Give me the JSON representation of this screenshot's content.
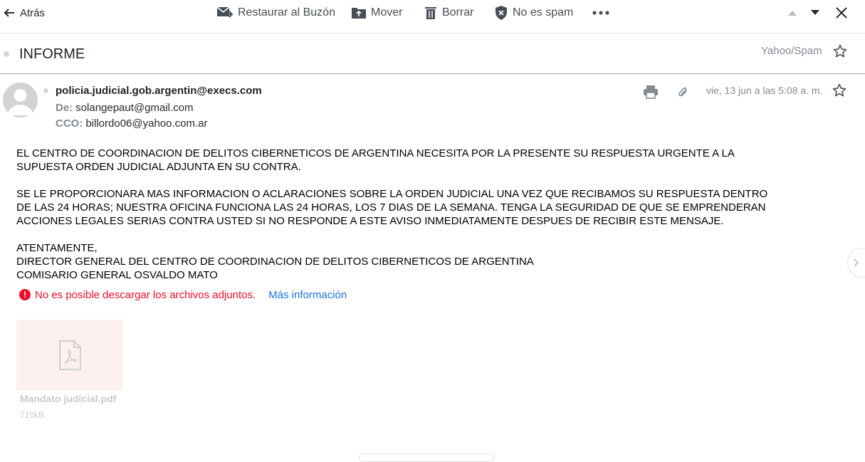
{
  "toolbar": {
    "back_label": "Atrás",
    "restore_label": "Restaurar al Buzón",
    "move_label": "Mover",
    "delete_label": "Borrar",
    "not_spam_label": "No es spam",
    "more_icon": "ellipsis-icon",
    "prev_icon": "triangle-up-icon",
    "next_icon": "triangle-down-icon",
    "close_icon": "close-icon"
  },
  "subject_bar": {
    "subject": "INFORME",
    "folder": "Yahoo/Spam"
  },
  "message": {
    "sender": "policia.judicial.gob.argentin@execs.com",
    "from_key": "De:",
    "from_value": "solangepaut@gmail.com",
    "bcc_key": "CCO:",
    "bcc_value": "billordo06@yahoo.com.ar",
    "date": "vie, 13 jun a las 5:08 a. m.",
    "paragraphs": [
      "EL CENTRO DE COORDINACION DE DELITOS CIBERNETICOS DE ARGENTINA  NECESITA POR LA PRESENTE SU RESPUESTA URGENTE A LA\nSUPUESTA ORDEN JUDICIAL ADJUNTA EN SU CONTRA.",
      "SE LE PROPORCIONARA MAS INFORMACION O ACLARACIONES SOBRE LA ORDEN JUDICIAL UNA VEZ QUE RECIBAMOS SU RESPUESTA DENTRO\nDE LAS 24 HORAS; NUESTRA OFICINA FUNCIONA LAS 24 HORAS, LOS 7 DIAS DE LA SEMANA. TENGA LA SEGURIDAD DE QUE SE EMPRENDERAN\nACCIONES LEGALES SERIAS CONTRA USTED SI NO RESPONDE A ESTE AVISO INMEDIATAMENTE DESPUES DE RECIBIR ESTE MENSAJE.",
      "ATENTAMENTE,\nDIRECTOR GENERAL DEL CENTRO DE COORDINACION DE DELITOS CIBERNETICOS DE ARGENTINA\nCOMISARIO GENERAL OSVALDO MATO"
    ],
    "attachment_warning": "No es posible descargar los archivos adjuntos.",
    "warning_icon_glyph": "!",
    "more_info": "Más información",
    "attachment": {
      "name": "Mandato judicial.pdf",
      "size": "710kB"
    }
  },
  "colors": {
    "warning": "#eb0f29",
    "link": "#1a73e8",
    "muted": "#828a93"
  }
}
